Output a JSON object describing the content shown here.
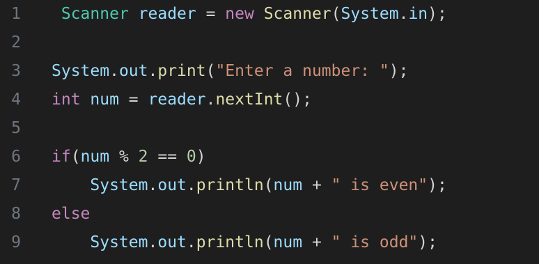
{
  "editor": {
    "colors": {
      "background": "#1e1e1e",
      "line_number": "#6e7681",
      "plain": "#d4d4d4",
      "type": "#4ec9b0",
      "variable": "#9cdcfe",
      "keyword": "#c586c0",
      "function": "#dcdcaa",
      "string": "#ce9178",
      "number": "#b5cea8"
    },
    "lines": [
      {
        "number": "1",
        "tokens": [
          {
            "text": " ",
            "kind": "plain"
          },
          {
            "text": "Scanner",
            "kind": "type"
          },
          {
            "text": " ",
            "kind": "plain"
          },
          {
            "text": "reader",
            "kind": "var"
          },
          {
            "text": " = ",
            "kind": "op"
          },
          {
            "text": "new",
            "kind": "kw"
          },
          {
            "text": " ",
            "kind": "plain"
          },
          {
            "text": "Scanner",
            "kind": "fn"
          },
          {
            "text": "(",
            "kind": "plain"
          },
          {
            "text": "System",
            "kind": "var"
          },
          {
            "text": ".",
            "kind": "plain"
          },
          {
            "text": "in",
            "kind": "var"
          },
          {
            "text": ");",
            "kind": "plain"
          }
        ]
      },
      {
        "number": "2",
        "tokens": []
      },
      {
        "number": "3",
        "tokens": [
          {
            "text": "System",
            "kind": "var"
          },
          {
            "text": ".",
            "kind": "plain"
          },
          {
            "text": "out",
            "kind": "var"
          },
          {
            "text": ".",
            "kind": "plain"
          },
          {
            "text": "print",
            "kind": "fn"
          },
          {
            "text": "(",
            "kind": "plain"
          },
          {
            "text": "\"Enter a number: \"",
            "kind": "str"
          },
          {
            "text": ");",
            "kind": "plain"
          }
        ]
      },
      {
        "number": "4",
        "tokens": [
          {
            "text": "int",
            "kind": "kw"
          },
          {
            "text": " ",
            "kind": "plain"
          },
          {
            "text": "num",
            "kind": "var"
          },
          {
            "text": " = ",
            "kind": "op"
          },
          {
            "text": "reader",
            "kind": "var"
          },
          {
            "text": ".",
            "kind": "plain"
          },
          {
            "text": "nextInt",
            "kind": "fn"
          },
          {
            "text": "();",
            "kind": "plain"
          }
        ]
      },
      {
        "number": "5",
        "tokens": []
      },
      {
        "number": "6",
        "tokens": [
          {
            "text": "if",
            "kind": "kw"
          },
          {
            "text": "(",
            "kind": "plain"
          },
          {
            "text": "num",
            "kind": "var"
          },
          {
            "text": " % ",
            "kind": "op"
          },
          {
            "text": "2",
            "kind": "num"
          },
          {
            "text": " == ",
            "kind": "op"
          },
          {
            "text": "0",
            "kind": "num"
          },
          {
            "text": ")",
            "kind": "plain"
          }
        ]
      },
      {
        "number": "7",
        "tokens": [
          {
            "text": "    ",
            "kind": "plain"
          },
          {
            "text": "System",
            "kind": "var"
          },
          {
            "text": ".",
            "kind": "plain"
          },
          {
            "text": "out",
            "kind": "var"
          },
          {
            "text": ".",
            "kind": "plain"
          },
          {
            "text": "println",
            "kind": "fn"
          },
          {
            "text": "(",
            "kind": "plain"
          },
          {
            "text": "num",
            "kind": "var"
          },
          {
            "text": " + ",
            "kind": "op"
          },
          {
            "text": "\" is even\"",
            "kind": "str"
          },
          {
            "text": ");",
            "kind": "plain"
          }
        ]
      },
      {
        "number": "8",
        "tokens": [
          {
            "text": "else",
            "kind": "kw"
          }
        ]
      },
      {
        "number": "9",
        "tokens": [
          {
            "text": "    ",
            "kind": "plain"
          },
          {
            "text": "System",
            "kind": "var"
          },
          {
            "text": ".",
            "kind": "plain"
          },
          {
            "text": "out",
            "kind": "var"
          },
          {
            "text": ".",
            "kind": "plain"
          },
          {
            "text": "println",
            "kind": "fn"
          },
          {
            "text": "(",
            "kind": "plain"
          },
          {
            "text": "num",
            "kind": "var"
          },
          {
            "text": " + ",
            "kind": "op"
          },
          {
            "text": "\" is odd\"",
            "kind": "str"
          },
          {
            "text": ");",
            "kind": "plain"
          }
        ]
      }
    ]
  }
}
